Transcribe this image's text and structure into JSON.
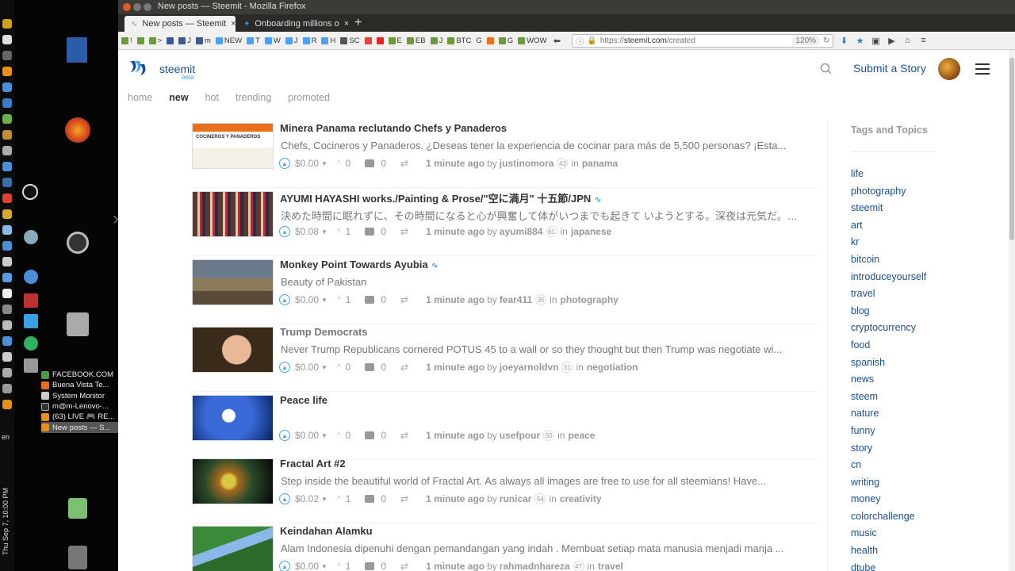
{
  "window": {
    "title": "New posts — Steemit - Mozilla Firefox"
  },
  "tabs": [
    {
      "label": "New posts — Steemit",
      "active": true
    },
    {
      "label": "Onboarding millions o",
      "active": false
    }
  ],
  "bookmarks": [
    "!",
    ">",
    "J",
    "m",
    "NEW",
    "T",
    "W",
    "J",
    "R",
    "H",
    "SC",
    "E",
    "EB",
    "J",
    "BTC",
    "G",
    "G",
    "WOW"
  ],
  "address": {
    "prefix": "https://",
    "domain": "steemit.com",
    "path": "/created",
    "zoom": "120%"
  },
  "desktop": {
    "clock": "Thu Sep 7, 10:00 PM",
    "lang": "en",
    "windows": [
      "FACEBOOK.COM",
      "Buena Vista Te...",
      "System Monitor",
      "m@m-Lenovo-...",
      "(63) LIVE 🎮 RE...",
      "New posts — S..."
    ]
  },
  "header": {
    "brand": "steemit",
    "brand_sub": "beta",
    "submit": "Submit a Story"
  },
  "subnav": [
    "home",
    "new",
    "hot",
    "trending",
    "promoted"
  ],
  "posts": [
    {
      "title": "Minera Panama reclutando Chefs y Panaderos",
      "body": "Chefs, Cocineros y Panaderos. ¿Deseas tener la experiencia de cocinar para más de 5,500 personas? ¡Esta...",
      "payout": "$0.00",
      "votes": "0",
      "comments": "0",
      "time": "1 minute ago",
      "author": "justinomora",
      "rep": "43",
      "category": "panama",
      "thumb_label": "COCINEROS Y PANADEROS"
    },
    {
      "title": "AYUMI HAYASHI works./Painting & Prose/\"空に満月\" 十五節/JPN",
      "body": "決めた時間に眠れずに、その時間になると心が興奮して体がいつまでも起きて いようとする。深夜は元気だ。然し、...",
      "payout": "$0.08",
      "votes": "1",
      "comments": "0",
      "time": "1 minute ago",
      "author": "ayumi884",
      "rep": "61",
      "category": "japanese"
    },
    {
      "title": "Monkey Point Towards Ayubia",
      "body": "Beauty of Pakistan",
      "payout": "$0.00",
      "votes": "1",
      "comments": "0",
      "time": "1 minute ago",
      "author": "fear411",
      "rep": "35",
      "category": "photography"
    },
    {
      "title": "Trump Democrats",
      "body": "Never Trump Republicans cornered POTUS 45 to a wall or so they thought but then Trump was negotiate wi...",
      "payout": "$0.00",
      "votes": "0",
      "comments": "0",
      "time": "1 minute ago",
      "author": "joeyarnoldvn",
      "rep": "51",
      "category": "negotiation"
    },
    {
      "title": "Peace life",
      "body": "",
      "payout": "$0.00",
      "votes": "0",
      "comments": "0",
      "time": "1 minute ago",
      "author": "usefpour",
      "rep": "50",
      "category": "peace"
    },
    {
      "title": "Fractal Art #2",
      "body": "Step inside the beautiful world of Fractal Art. As always all images are free to use for all steemians! Have...",
      "payout": "$0.02",
      "votes": "1",
      "comments": "0",
      "time": "1 minute ago",
      "author": "runicar",
      "rep": "54",
      "category": "creativity"
    },
    {
      "title": "Keindahan Alamku",
      "body": "Alam Indonesia dipenuhi dengan pemandangan yang indah . Membuat setiap mata manusia menjadi manja ...",
      "payout": "$0.00",
      "votes": "1",
      "comments": "0",
      "time": "1 minute ago",
      "author": "rahmadnhareza",
      "rep": "47",
      "category": "travel"
    }
  ],
  "sidebar": {
    "title": "Tags and Topics",
    "tags": [
      "life",
      "photography",
      "steemit",
      "art",
      "kr",
      "bitcoin",
      "introduceyourself",
      "travel",
      "blog",
      "cryptocurrency",
      "food",
      "spanish",
      "news",
      "steem",
      "nature",
      "funny",
      "story",
      "cn",
      "writing",
      "money",
      "colorchallenge",
      "music",
      "health",
      "dtube"
    ]
  },
  "colors": {
    "accent": "#1a5099",
    "link_blue": "#4ba2f2"
  }
}
